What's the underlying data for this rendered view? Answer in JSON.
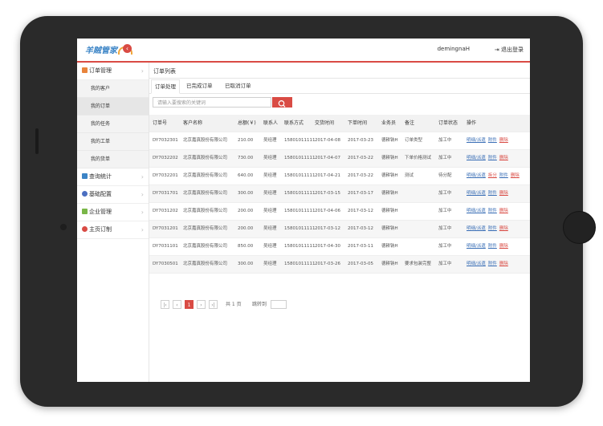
{
  "header": {
    "logo_text": "羊贼管家",
    "username": "demingnaH",
    "logout_label": "退出登录"
  },
  "sidebar": {
    "groups": [
      {
        "label": "订单管理",
        "color": "#e8843c"
      },
      {
        "label": "查询统计",
        "color": "#3b84c6"
      },
      {
        "label": "基础配置",
        "color": "#4b6fc1"
      },
      {
        "label": "企业管理",
        "color": "#7ab648"
      },
      {
        "label": "主页订制",
        "color": "#d94b44"
      }
    ],
    "sub_items": [
      {
        "label": "我的客户"
      },
      {
        "label": "我的订单"
      },
      {
        "label": "我的任务"
      },
      {
        "label": "我的工单"
      },
      {
        "label": "我的货单"
      }
    ]
  },
  "main": {
    "breadcrumb": "订单列表",
    "tabs": [
      {
        "label": "订单处理"
      },
      {
        "label": "已完成订单"
      },
      {
        "label": "已取消订单"
      }
    ],
    "search_placeholder": "请输入要搜索的关键词"
  },
  "table": {
    "headers": [
      "订单号",
      "客户名称",
      "总额(￥)",
      "联系人",
      "联系方式",
      "交货时间",
      "下单时间",
      "业务员",
      "备注",
      "订单状态",
      "操作"
    ],
    "rows": [
      {
        "id": "DY7032301",
        "customer": "北京嘉真股份有限公司",
        "total": "210.00",
        "contact": "吴经理",
        "phone": "15801011111",
        "delivery": "2017-04-08",
        "order_date": "2017-03-23",
        "sales": "德耕钠H",
        "note": "订单类型",
        "status": "加工中",
        "ops": [
          "明细/派遣",
          "附件",
          "删除"
        ]
      },
      {
        "id": "DY7032202",
        "customer": "北京嘉真股份有限公司",
        "total": "730.00",
        "contact": "吴经理",
        "phone": "15801011111",
        "delivery": "2017-04-07",
        "order_date": "2017-03-22",
        "sales": "德耕钠H",
        "note": "下单价格测试",
        "status": "加工中",
        "ops": [
          "明细/派遣",
          "附件",
          "删除"
        ]
      },
      {
        "id": "DY7032201",
        "customer": "北京嘉真股份有限公司",
        "total": "640.00",
        "contact": "吴经理",
        "phone": "15801011111",
        "delivery": "2017-04-21",
        "order_date": "2017-03-22",
        "sales": "德耕钠H",
        "note": "测试",
        "status": "待分配",
        "ops": [
          "明细/派遣",
          "拆分",
          "附件",
          "删除"
        ]
      },
      {
        "id": "DY7031701",
        "customer": "北京嘉真股份有限公司",
        "total": "300.00",
        "contact": "吴经理",
        "phone": "15801011111",
        "delivery": "2017-03-15",
        "order_date": "2017-03-17",
        "sales": "德耕钠H",
        "note": "",
        "status": "加工中",
        "ops": [
          "明细/派遣",
          "附件",
          "删除"
        ]
      },
      {
        "id": "DY7031202",
        "customer": "北京嘉真股份有限公司",
        "total": "200.00",
        "contact": "吴经理",
        "phone": "15801011111",
        "delivery": "2017-04-06",
        "order_date": "2017-03-12",
        "sales": "德耕钠H",
        "note": "",
        "status": "加工中",
        "ops": [
          "明细/派遣",
          "附件",
          "删除"
        ]
      },
      {
        "id": "DY7031201",
        "customer": "北京嘉真股份有限公司",
        "total": "200.00",
        "contact": "吴经理",
        "phone": "15801011111",
        "delivery": "2017-03-12",
        "order_date": "2017-03-12",
        "sales": "德耕钠H",
        "note": "",
        "status": "加工中",
        "ops": [
          "明细/派遣",
          "附件",
          "删除"
        ]
      },
      {
        "id": "DY7031101",
        "customer": "北京嘉真股份有限公司",
        "total": "850.00",
        "contact": "吴经理",
        "phone": "15801011111",
        "delivery": "2017-04-30",
        "order_date": "2017-03-11",
        "sales": "德耕钠H",
        "note": "",
        "status": "加工中",
        "ops": [
          "明细/派遣",
          "附件",
          "删除"
        ]
      },
      {
        "id": "DY7030501",
        "customer": "北京嘉真股份有限公司",
        "total": "300.00",
        "contact": "吴经理",
        "phone": "15801011111",
        "delivery": "2017-03-26",
        "order_date": "2017-03-05",
        "sales": "德耕钠H",
        "note": "要求包装完整",
        "status": "加工中",
        "ops": [
          "明细/派遣",
          "附件",
          "删除"
        ]
      }
    ]
  },
  "pagination": {
    "current_page": "1",
    "total_label": "共 1 页",
    "jump_label": "跳转到"
  },
  "colors": {
    "accent": "#d94b44",
    "link": "#3b6fb6"
  }
}
